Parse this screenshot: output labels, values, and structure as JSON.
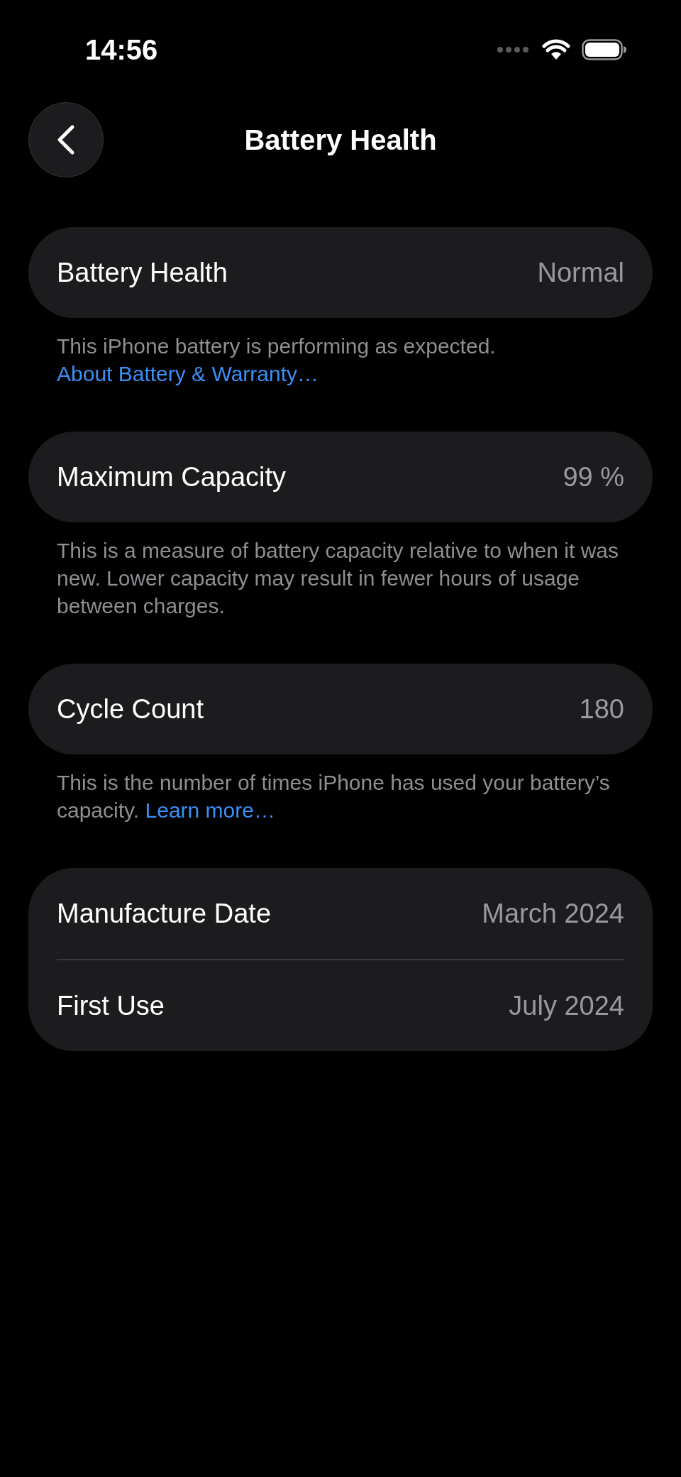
{
  "status_bar": {
    "time": "14:56"
  },
  "header": {
    "title": "Battery Health"
  },
  "sections": [
    {
      "rows": [
        {
          "label": "Battery Health",
          "value": "Normal"
        }
      ],
      "footer": {
        "text": "This iPhone battery is performing as expected.",
        "link": "About Battery & Warranty…"
      }
    },
    {
      "rows": [
        {
          "label": "Maximum Capacity",
          "value": "99 %"
        }
      ],
      "footer": {
        "text": "This is a measure of battery capacity relative to when it was new. Lower capacity may result in fewer hours of usage between charges."
      }
    },
    {
      "rows": [
        {
          "label": "Cycle Count",
          "value": "180"
        }
      ],
      "footer": {
        "text": "This is the number of times iPhone has used your battery’s capacity.",
        "link": "Learn more…"
      }
    },
    {
      "rows": [
        {
          "label": "Manufacture Date",
          "value": "March 2024"
        },
        {
          "label": "First Use",
          "value": "July 2024"
        }
      ]
    }
  ]
}
